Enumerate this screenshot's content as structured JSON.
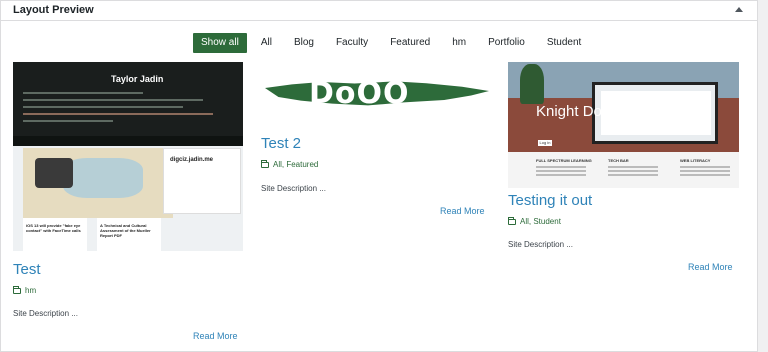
{
  "panel": {
    "title": "Layout Preview"
  },
  "filters": [
    {
      "label": "Show all",
      "active": true
    },
    {
      "label": "All"
    },
    {
      "label": "Blog"
    },
    {
      "label": "Faculty"
    },
    {
      "label": "Featured"
    },
    {
      "label": "hm"
    },
    {
      "label": "Portfolio"
    },
    {
      "label": "Student"
    }
  ],
  "items": [
    {
      "title": "Test",
      "categories": "hm",
      "description": "Site Description ...",
      "read_more": "Read More",
      "thumbnail": {
        "name": "Taylor Jadin",
        "card_title": "digciz.jadin.me",
        "small_titles": [
          "iOS 13 will provide \"fake eye contact\" with FaceTime calls",
          "A Technical and Cultural Assessment of the Mueller Report PDF"
        ]
      }
    },
    {
      "title": "Test 2",
      "categories": "All, Featured",
      "description": "Site Description ...",
      "read_more": "Read More",
      "thumbnail": {
        "logo": "DoOO"
      }
    },
    {
      "title": "Testing it out",
      "categories": "All, Student",
      "description": "Site Description ...",
      "read_more": "Read More",
      "thumbnail": {
        "heading": "Knight Domains",
        "login": "Log in",
        "columns": [
          "FULL SPECTRUM LEARNING",
          "TECH BAR",
          "WEB LITERACY"
        ]
      }
    }
  ],
  "colors": {
    "accent_green": "#2d6b3a",
    "link_blue": "#2f83b8"
  }
}
